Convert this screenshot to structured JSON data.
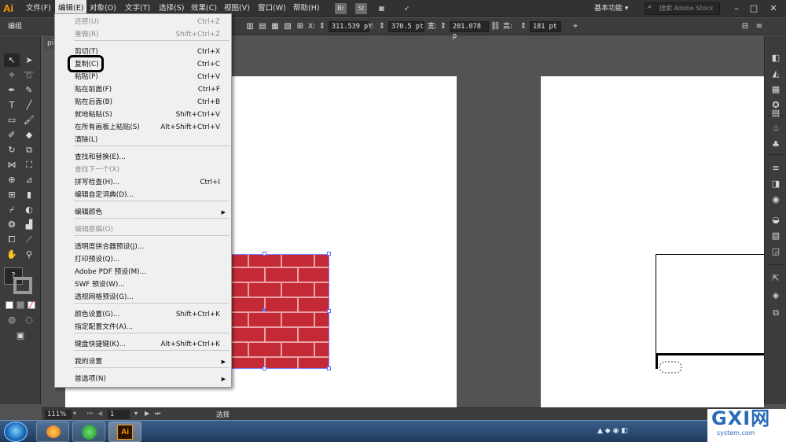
{
  "app": {
    "logo": "Ai"
  },
  "menubar": {
    "items": [
      "文件(F)",
      "编辑(E)",
      "对象(O)",
      "文字(T)",
      "选择(S)",
      "效果(C)",
      "视图(V)",
      "窗口(W)",
      "帮助(H)"
    ],
    "bridge_label": "Br",
    "stock_label": "St",
    "workspace": "基本功能",
    "search_placeholder": "搜索 Adobe Stock"
  },
  "controlbar": {
    "selection_label": "编组",
    "x_label": "X:",
    "x_value": "311.539 p",
    "y_label": "Y:",
    "y_value": "370.5 pt",
    "w_label": "宽:",
    "w_value": "201.078 p",
    "h_label": "高:",
    "h_value": "181 pt"
  },
  "document": {
    "tab_label": "pi"
  },
  "statusbar": {
    "zoom": "111%",
    "artboard": "1",
    "tool": "选择"
  },
  "edit_menu": {
    "items": [
      {
        "label": "还原(U)",
        "shortcut": "Ctrl+Z",
        "disabled": true
      },
      {
        "label": "重做(R)",
        "shortcut": "Shift+Ctrl+Z",
        "disabled": true
      },
      {
        "label": "剪切(T)",
        "shortcut": "Ctrl+X"
      },
      {
        "label": "复制(C)",
        "shortcut": "Ctrl+C"
      },
      {
        "label": "粘贴(P)",
        "shortcut": "Ctrl+V"
      },
      {
        "label": "贴在前面(F)",
        "shortcut": "Ctrl+F"
      },
      {
        "label": "贴在后面(B)",
        "shortcut": "Ctrl+B"
      },
      {
        "label": "就地粘贴(S)",
        "shortcut": "Shift+Ctrl+V"
      },
      {
        "label": "在所有画板上粘贴(S)",
        "shortcut": "Alt+Shift+Ctrl+V"
      },
      {
        "label": "清除(L)",
        "shortcut": ""
      },
      {
        "label": "查找和替换(E)...",
        "shortcut": ""
      },
      {
        "label": "查找下一个(X)",
        "shortcut": "",
        "disabled": true
      },
      {
        "label": "拼写检查(H)...",
        "shortcut": "Ctrl+I"
      },
      {
        "label": "编辑自定词典(D)...",
        "shortcut": ""
      },
      {
        "label": "编辑颜色",
        "shortcut": "",
        "submenu": true
      },
      {
        "label": "编辑原稿(O)",
        "shortcut": "",
        "disabled": true
      },
      {
        "label": "透明度拼合器预设(J)...",
        "shortcut": ""
      },
      {
        "label": "打印预设(Q)...",
        "shortcut": ""
      },
      {
        "label": "Adobe PDF 预设(M)...",
        "shortcut": ""
      },
      {
        "label": "SWF 预设(W)...",
        "shortcut": ""
      },
      {
        "label": "透视网格预设(G)...",
        "shortcut": ""
      },
      {
        "label": "颜色设置(G)...",
        "shortcut": "Shift+Ctrl+K"
      },
      {
        "label": "指定配置文件(A)...",
        "shortcut": ""
      },
      {
        "label": "键盘快捷键(K)...",
        "shortcut": "Alt+Shift+Ctrl+K"
      },
      {
        "label": "我的设置",
        "shortcut": "",
        "submenu": true
      },
      {
        "label": "首选项(N)",
        "shortcut": "",
        "submenu": true
      }
    ]
  },
  "taskbar": {
    "ai_label": "Ai"
  },
  "watermark": {
    "brand": "GXI网",
    "site": "system.com"
  },
  "colors": {
    "brick": "#c42a35",
    "mortar": "#e9a3a8",
    "accent": "#ff9a00",
    "selection": "#5c6cff"
  }
}
